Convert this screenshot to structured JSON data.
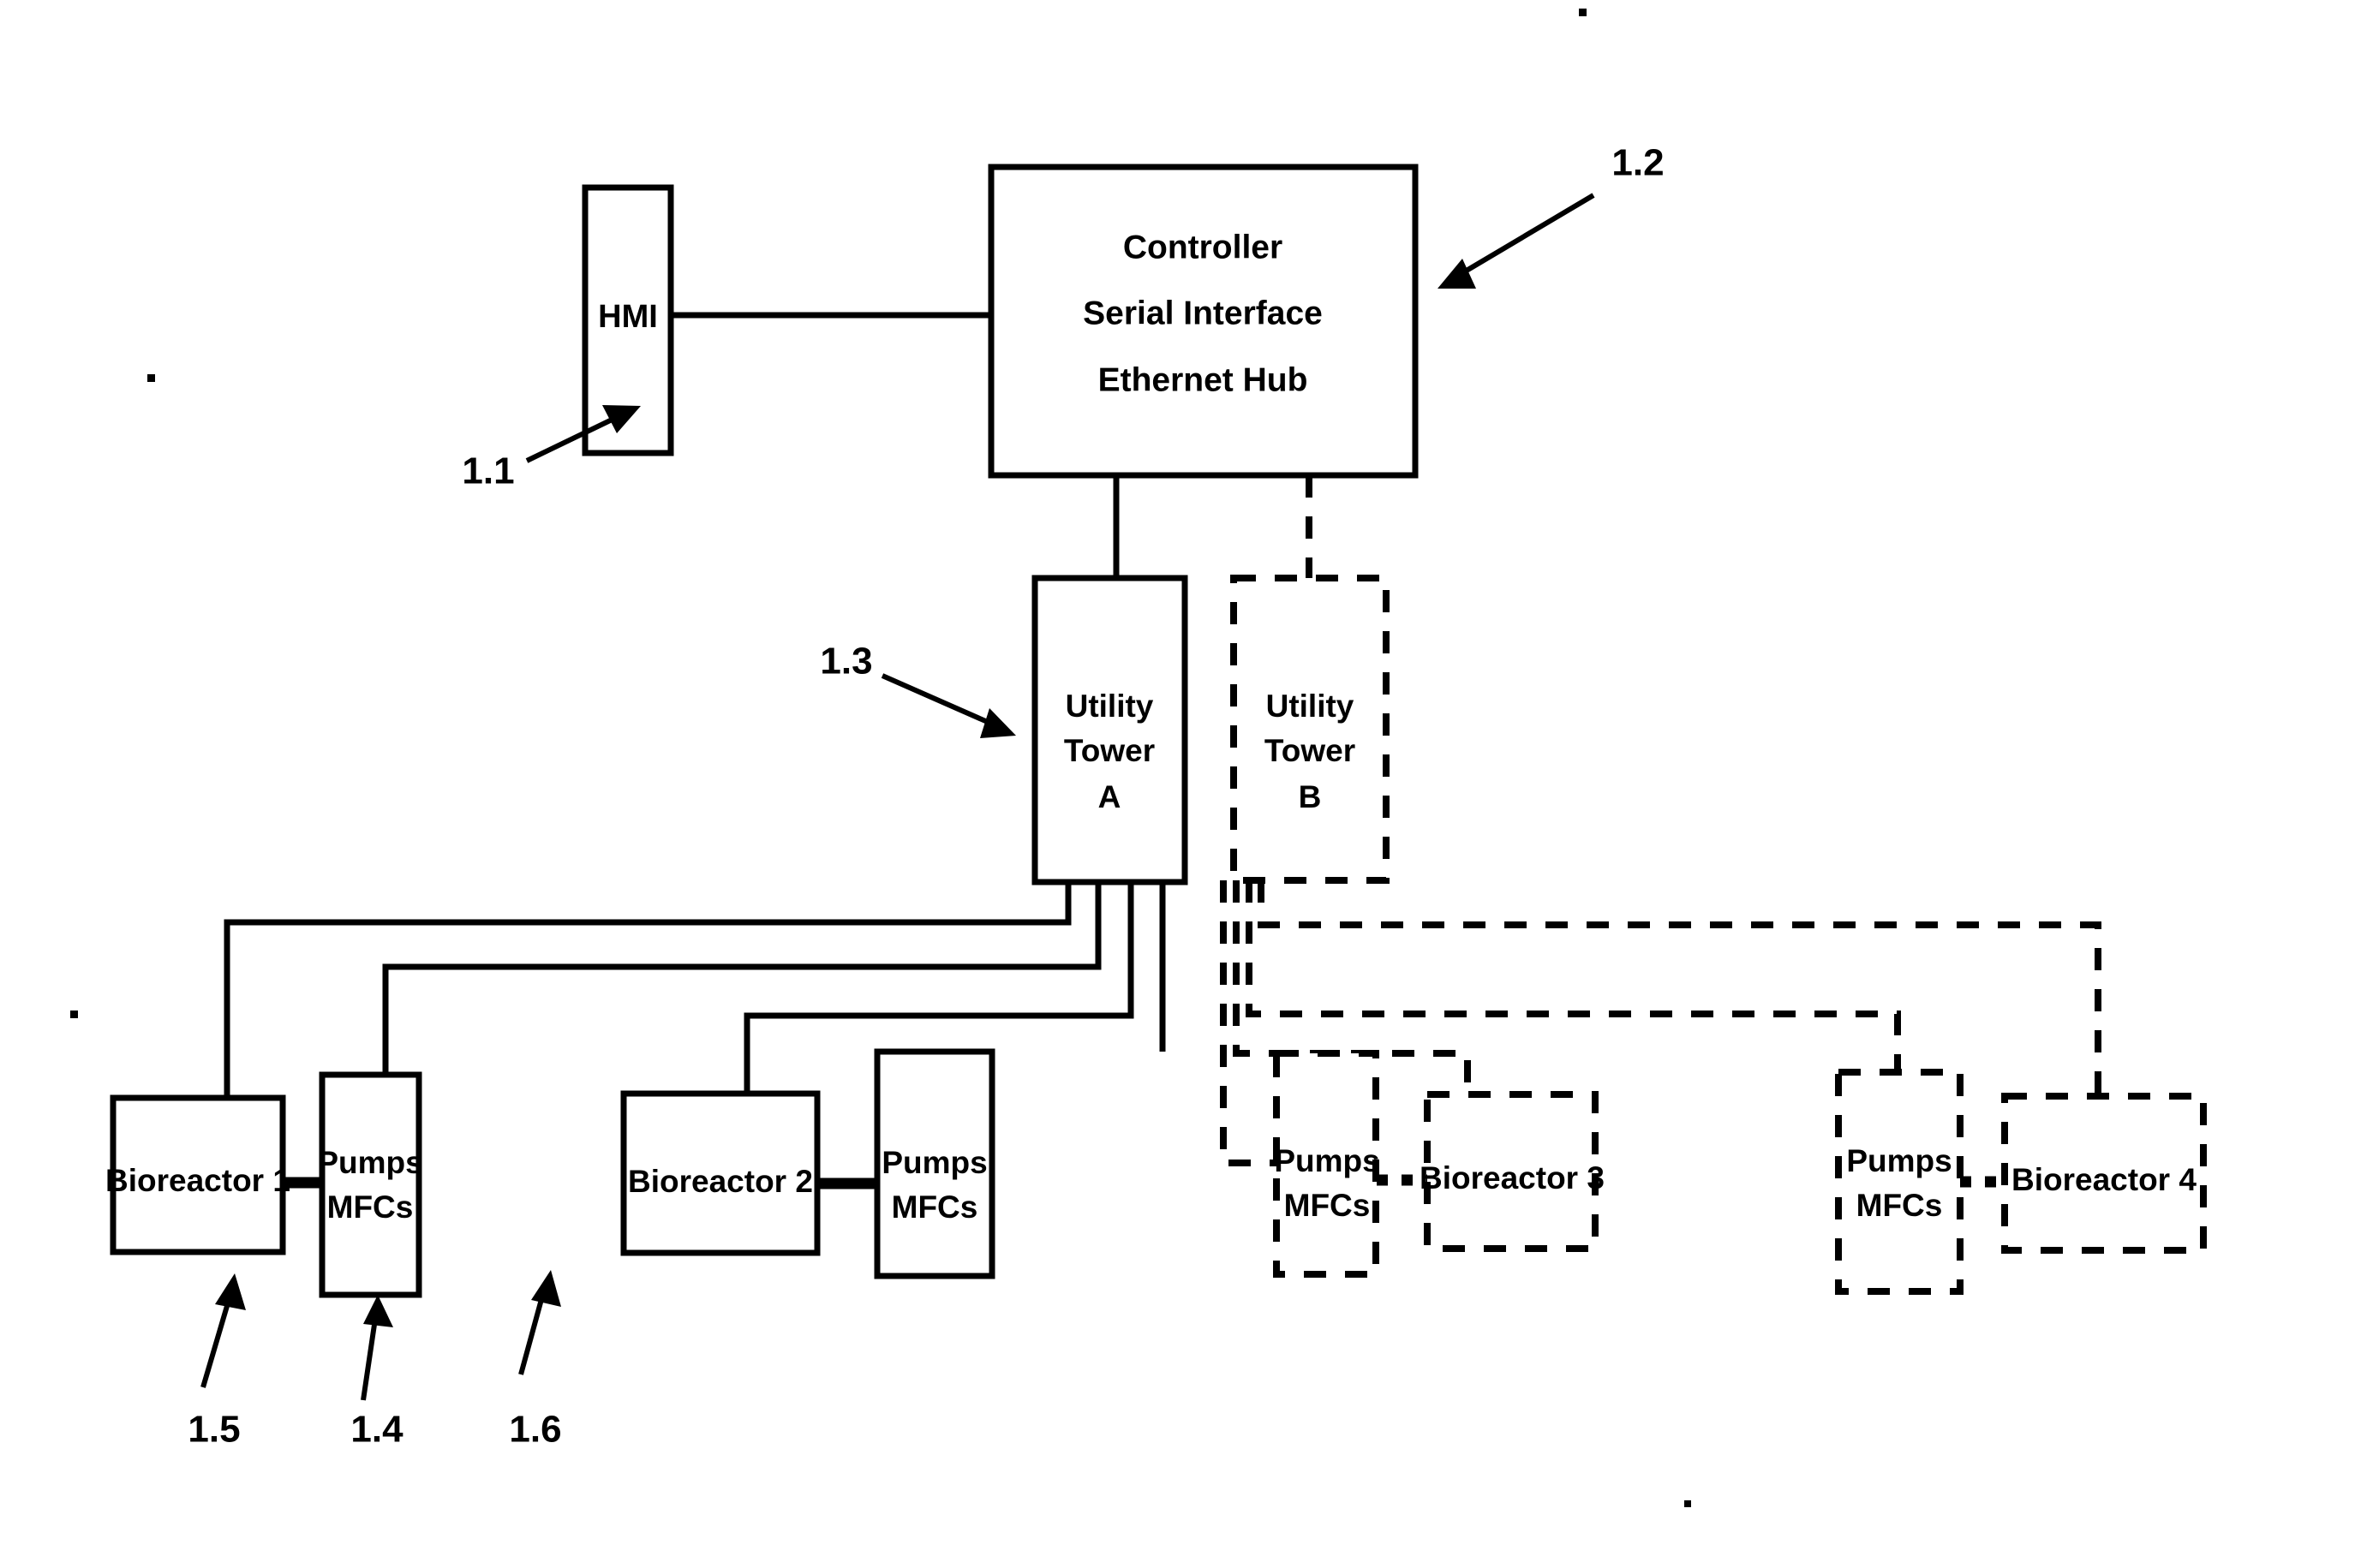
{
  "diagram": {
    "title": "Bioreactor Control System Block Diagram",
    "ink_color": "#000000",
    "background_color": "#ffffff",
    "nodes": {
      "hmi": {
        "label": "HMI",
        "style": "solid"
      },
      "controller": {
        "line1": "Controller",
        "line2": "Serial Interface",
        "line3": "Ethernet Hub",
        "style": "solid"
      },
      "utility_tower_a": {
        "line1": "Utility",
        "line2": "Tower",
        "line3": "A",
        "style": "solid"
      },
      "utility_tower_b": {
        "line1": "Utility",
        "line2": "Tower",
        "line3": "B",
        "style": "dashed"
      },
      "bioreactor_1": {
        "label": "Bioreactor 1",
        "style": "solid"
      },
      "bioreactor_2": {
        "label": "Bioreactor 2",
        "style": "solid"
      },
      "bioreactor_3": {
        "label": "Bioreactor 3",
        "style": "dashed"
      },
      "bioreactor_4": {
        "label": "Bioreactor 4",
        "style": "dashed"
      },
      "pumps_mfcs_1": {
        "line1": "Pumps",
        "line2": "MFCs",
        "style": "solid"
      },
      "pumps_mfcs_2": {
        "line1": "Pumps",
        "line2": "MFCs",
        "style": "solid"
      },
      "pumps_mfcs_3": {
        "line1": "Pumps",
        "line2": "MFCs",
        "style": "dashed"
      },
      "pumps_mfcs_4": {
        "line1": "Pumps",
        "line2": "MFCs",
        "style": "dashed"
      }
    },
    "reference_labels": {
      "hmi_ref": "1.1",
      "controller_ref": "1.2",
      "utility_tower_ref": "1.3",
      "pumps_mfcs_ref": "1.4",
      "bioreactor_1_ref": "1.5",
      "bioreactor_2_ref": "1.6"
    }
  }
}
